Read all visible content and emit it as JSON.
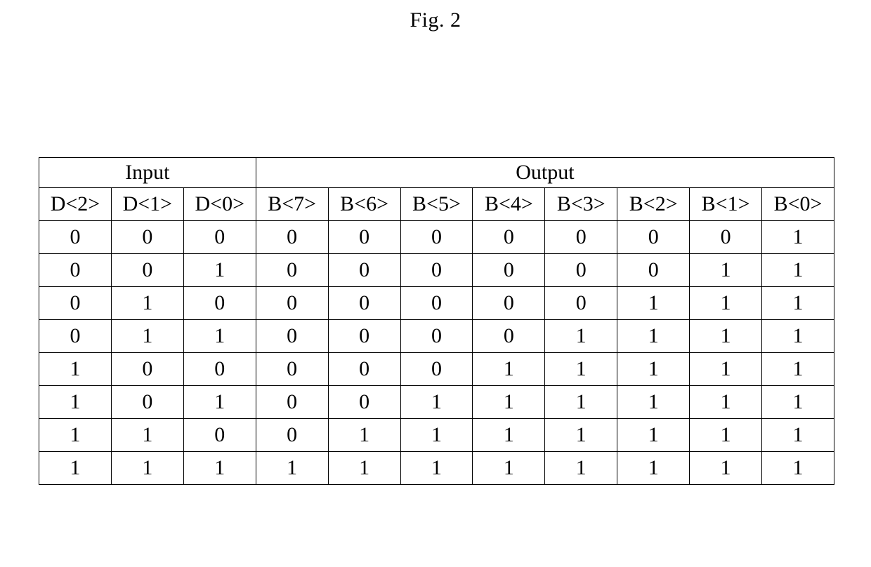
{
  "caption": "Fig. 2",
  "chart_data": {
    "type": "table",
    "title": "Fig. 2",
    "group_headers": {
      "input": "Input",
      "output": "Output"
    },
    "input_columns": [
      "D<2>",
      "D<1>",
      "D<0>"
    ],
    "output_columns": [
      "B<7>",
      "B<6>",
      "B<5>",
      "B<4>",
      "B<3>",
      "B<2>",
      "B<1>",
      "B<0>"
    ],
    "rows": [
      {
        "in": [
          0,
          0,
          0
        ],
        "out": [
          0,
          0,
          0,
          0,
          0,
          0,
          0,
          1
        ]
      },
      {
        "in": [
          0,
          0,
          1
        ],
        "out": [
          0,
          0,
          0,
          0,
          0,
          0,
          1,
          1
        ]
      },
      {
        "in": [
          0,
          1,
          0
        ],
        "out": [
          0,
          0,
          0,
          0,
          0,
          1,
          1,
          1
        ]
      },
      {
        "in": [
          0,
          1,
          1
        ],
        "out": [
          0,
          0,
          0,
          0,
          1,
          1,
          1,
          1
        ]
      },
      {
        "in": [
          1,
          0,
          0
        ],
        "out": [
          0,
          0,
          0,
          1,
          1,
          1,
          1,
          1
        ]
      },
      {
        "in": [
          1,
          0,
          1
        ],
        "out": [
          0,
          0,
          1,
          1,
          1,
          1,
          1,
          1
        ]
      },
      {
        "in": [
          1,
          1,
          0
        ],
        "out": [
          0,
          1,
          1,
          1,
          1,
          1,
          1,
          1
        ]
      },
      {
        "in": [
          1,
          1,
          1
        ],
        "out": [
          1,
          1,
          1,
          1,
          1,
          1,
          1,
          1
        ]
      }
    ]
  }
}
